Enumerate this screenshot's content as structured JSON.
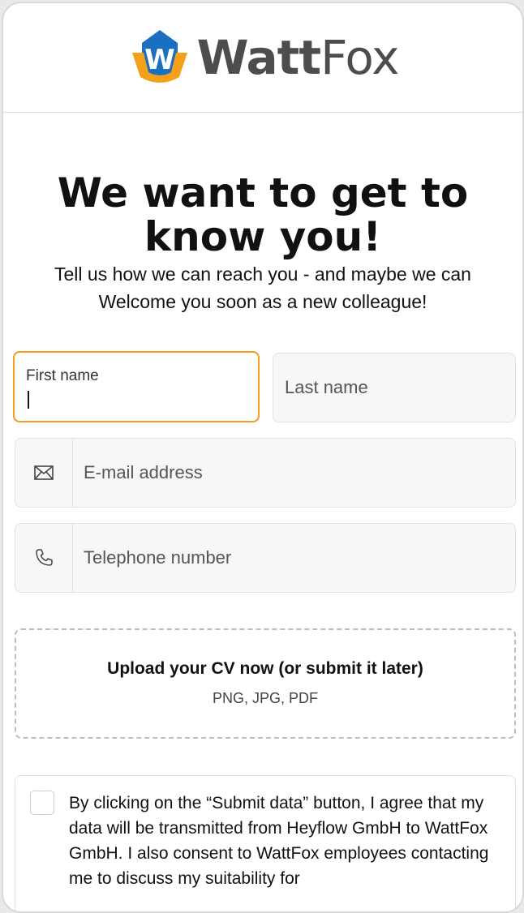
{
  "brand": {
    "name_part1": "Watt",
    "name_part2": "Fox",
    "logo_letter": "W"
  },
  "heading": {
    "title": "We want to get to know you!",
    "subtitle": "Tell us how we can reach you - and maybe we can Welcome you soon as a new colleague!"
  },
  "form": {
    "first_name_label": "First name",
    "first_name_value": "",
    "last_name_placeholder": "Last name",
    "email_placeholder": "E-mail address",
    "phone_placeholder": "Telephone number",
    "upload_title": "Upload your CV now (or submit it later)",
    "upload_types": "PNG, JPG, PDF",
    "consent_text": "By clicking on the “Submit data” button, I agree that my data will be transmitted from Heyflow GmbH to WattFox GmbH. I also consent to WattFox employees contacting me to discuss my suitability for"
  },
  "colors": {
    "accent": "#f59d1e",
    "logo_blue": "#1a6fbf",
    "logo_orange": "#f5a01a",
    "logo_text": "#4d4d4d"
  },
  "icons": {
    "email": "envelope-icon",
    "phone": "phone-icon"
  }
}
